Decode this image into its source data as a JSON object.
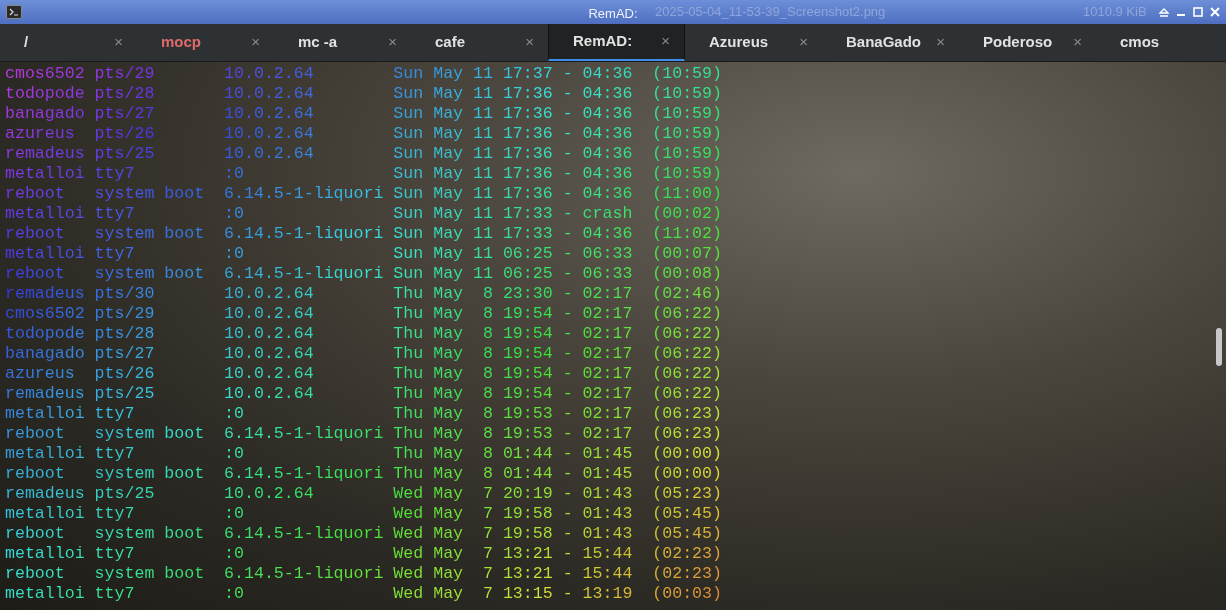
{
  "window": {
    "title": "RemAD:"
  },
  "background_texts": [
    "2025-05-04_11-53-39_Screenshot2.png",
    "1010.9 KiB"
  ],
  "tabs": [
    {
      "label": "/",
      "selected": false,
      "alert": false,
      "close": "×"
    },
    {
      "label": "mocp",
      "selected": false,
      "alert": true,
      "close": "×"
    },
    {
      "label": "mc -a",
      "selected": false,
      "alert": false,
      "close": "×"
    },
    {
      "label": "cafe",
      "selected": false,
      "alert": false,
      "close": "×"
    },
    {
      "label": "RemAD:",
      "selected": true,
      "alert": false,
      "close": "×"
    },
    {
      "label": "Azureus",
      "selected": false,
      "alert": false,
      "close": "×"
    },
    {
      "label": "BanaGado",
      "selected": false,
      "alert": false,
      "close": "×"
    },
    {
      "label": "Poderoso",
      "selected": false,
      "alert": false,
      "close": "×"
    },
    {
      "label": "cmos",
      "selected": false,
      "alert": false
    }
  ],
  "terminal": {
    "lines": [
      "cmos6502 pts/29       10.0.2.64        Sun May 11 17:37 - 04:36  (10:59)",
      "todopode pts/28       10.0.2.64        Sun May 11 17:36 - 04:36  (10:59)",
      "banagado pts/27       10.0.2.64        Sun May 11 17:36 - 04:36  (10:59)",
      "azureus  pts/26       10.0.2.64        Sun May 11 17:36 - 04:36  (10:59)",
      "remadeus pts/25       10.0.2.64        Sun May 11 17:36 - 04:36  (10:59)",
      "metalloi tty7         :0               Sun May 11 17:36 - 04:36  (10:59)",
      "reboot   system boot  6.14.5-1-liquori Sun May 11 17:36 - 04:36  (11:00)",
      "metalloi tty7         :0               Sun May 11 17:33 - crash  (00:02)",
      "reboot   system boot  6.14.5-1-liquori Sun May 11 17:33 - 04:36  (11:02)",
      "metalloi tty7         :0               Sun May 11 06:25 - 06:33  (00:07)",
      "reboot   system boot  6.14.5-1-liquori Sun May 11 06:25 - 06:33  (00:08)",
      "remadeus pts/30       10.0.2.64        Thu May  8 23:30 - 02:17  (02:46)",
      "cmos6502 pts/29       10.0.2.64        Thu May  8 19:54 - 02:17  (06:22)",
      "todopode pts/28       10.0.2.64        Thu May  8 19:54 - 02:17  (06:22)",
      "banagado pts/27       10.0.2.64        Thu May  8 19:54 - 02:17  (06:22)",
      "azureus  pts/26       10.0.2.64        Thu May  8 19:54 - 02:17  (06:22)",
      "remadeus pts/25       10.0.2.64        Thu May  8 19:54 - 02:17  (06:22)",
      "metalloi tty7         :0               Thu May  8 19:53 - 02:17  (06:23)",
      "reboot   system boot  6.14.5-1-liquori Thu May  8 19:53 - 02:17  (06:23)",
      "metalloi tty7         :0               Thu May  8 01:44 - 01:45  (00:00)",
      "reboot   system boot  6.14.5-1-liquori Thu May  8 01:44 - 01:45  (00:00)",
      "remadeus pts/25       10.0.2.64        Wed May  7 20:19 - 01:43  (05:23)",
      "metalloi tty7         :0               Wed May  7 19:58 - 01:43  (05:45)",
      "reboot   system boot  6.14.5-1-liquori Wed May  7 19:58 - 01:43  (05:45)",
      "metalloi tty7         :0               Wed May  7 13:21 - 15:44  (02:23)",
      "reboot   system boot  6.14.5-1-liquori Wed May  7 13:21 - 15:44  (02:23)",
      "metalloi tty7         :0               Wed May  7 13:15 - 13:19  (00:03)"
    ]
  }
}
